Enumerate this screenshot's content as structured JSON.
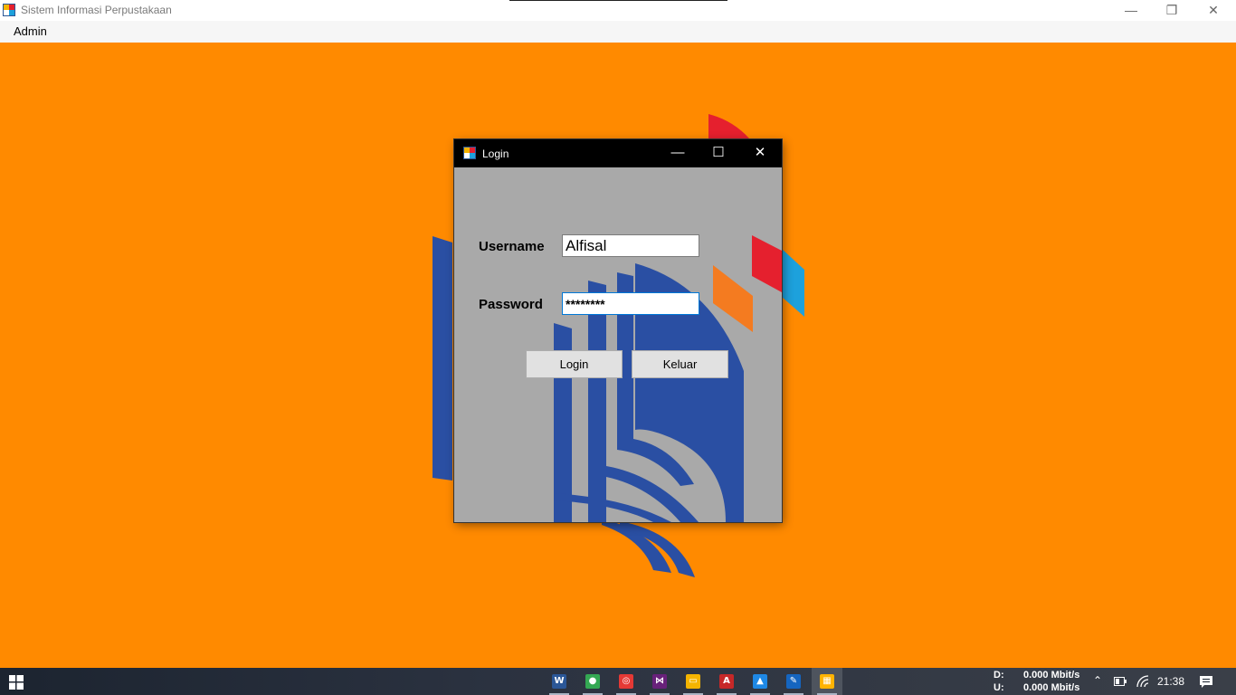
{
  "app": {
    "title": "Sistem Informasi Perpustakaan",
    "icon": "app-grid-icon",
    "minimize_glyph": "—",
    "restore_glyph": "❐",
    "close_glyph": "✕"
  },
  "menu": {
    "items": [
      {
        "label": "Admin"
      }
    ]
  },
  "dialog": {
    "title": "Login",
    "minimize_glyph": "—",
    "maximize_glyph": "☐",
    "close_glyph": "✕",
    "username_label": "Username",
    "username_value": "Alfisal",
    "password_label": "Password",
    "password_value": "********",
    "login_button": "Login",
    "exit_button": "Keluar"
  },
  "taskbar": {
    "apps": [
      {
        "name": "word-icon",
        "glyph": "W",
        "color": "#2b5797"
      },
      {
        "name": "chrome-icon",
        "glyph": "●",
        "color": "#34a853"
      },
      {
        "name": "app-red-icon",
        "glyph": "◎",
        "color": "#e53935"
      },
      {
        "name": "visual-studio-icon",
        "glyph": "⋈",
        "color": "#68217a"
      },
      {
        "name": "file-explorer-icon",
        "glyph": "▭",
        "color": "#f4b400"
      },
      {
        "name": "acrobat-icon",
        "glyph": "A",
        "color": "#c62828"
      },
      {
        "name": "photos-icon",
        "glyph": "▲",
        "color": "#1e88e5"
      },
      {
        "name": "app-tool-icon",
        "glyph": "✎",
        "color": "#1565c0"
      },
      {
        "name": "library-app-icon",
        "glyph": "▦",
        "color": "#ffb300"
      }
    ],
    "net_down_label": "D:",
    "net_down_value": "0.000 Mbit/s",
    "net_up_label": "U:",
    "net_up_value": "0.000 Mbit/s",
    "clock": "21:38"
  },
  "colors": {
    "workspace": "#ff8a00",
    "dialog_body": "#a9a9a9",
    "logo_blue": "#2a4fa3",
    "logo_red": "#e5202e",
    "logo_orange": "#f47b20",
    "logo_cyan": "#1da1dc"
  }
}
